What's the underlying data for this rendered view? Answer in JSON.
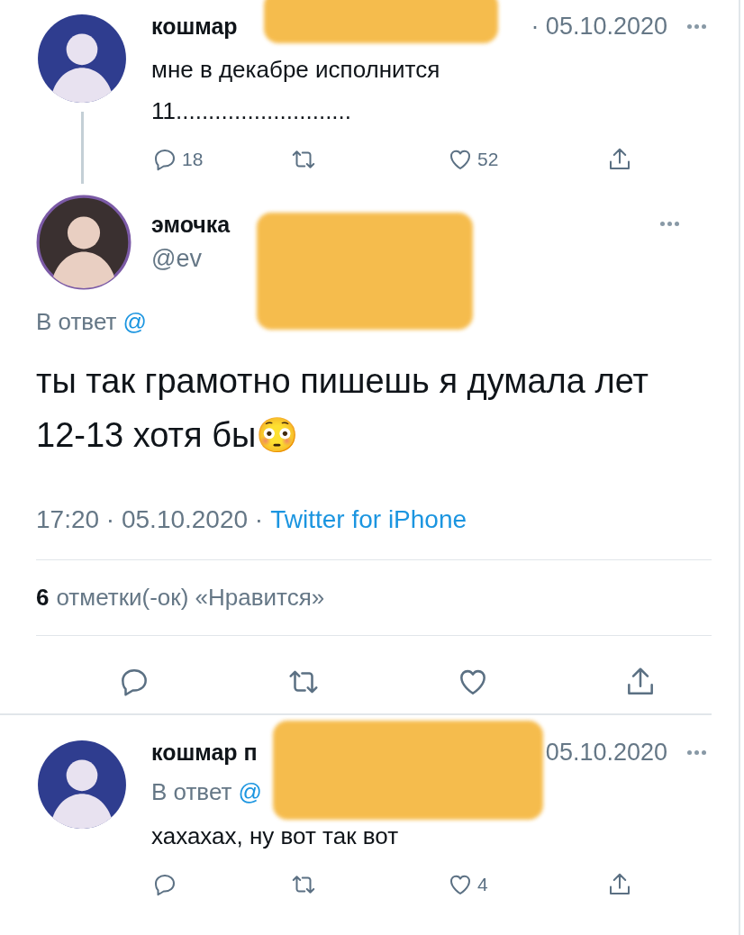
{
  "thread_tweet": {
    "name": "кошмар",
    "date": "· 05.10.2020",
    "text": "мне в декабре исполнится\n11...........................",
    "actions": [
      {
        "kind": "reply",
        "count": "18"
      },
      {
        "kind": "retweet"
      },
      {
        "kind": "like",
        "count": "52"
      },
      {
        "kind": "share"
      }
    ]
  },
  "main_tweet": {
    "name": "эмочка",
    "handle": "@ev",
    "reply_label": "В ответ",
    "reply_handle": "@",
    "text": "ты так грамотно пишешь я думала лет 12-13 хотя бы😳",
    "time": "17:20 · 05.10.2020 ·",
    "source": "Twitter for iPhone",
    "likes_count": "6",
    "likes_label": "отметки(-ок) «Нравится»",
    "actions": [
      {
        "kind": "reply"
      },
      {
        "kind": "retweet"
      },
      {
        "kind": "like"
      },
      {
        "kind": "share"
      }
    ]
  },
  "reply_tweet": {
    "name": "кошмар п",
    "date": "05.10.2020",
    "reply_label": "В ответ",
    "reply_handle": "@",
    "text": "хахахах, ну вот так вот",
    "actions": [
      {
        "kind": "reply"
      },
      {
        "kind": "retweet"
      },
      {
        "kind": "like",
        "count": "4"
      },
      {
        "kind": "share"
      }
    ]
  }
}
